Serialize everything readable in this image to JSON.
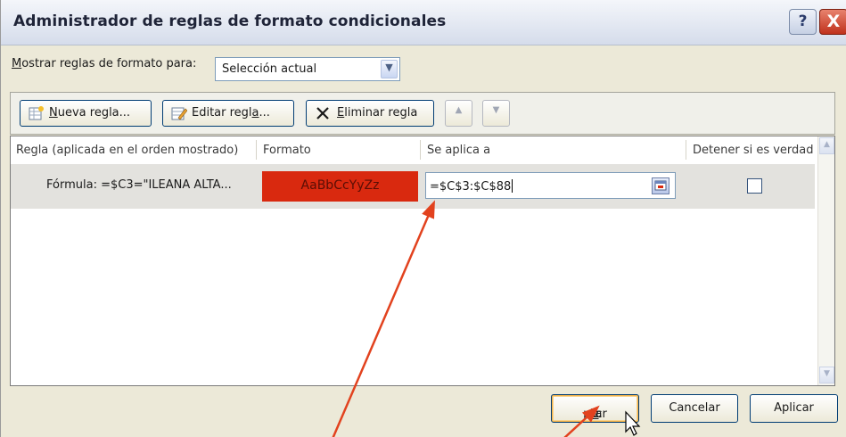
{
  "dialog": {
    "title": "Administrador de reglas de formato condicionales",
    "help_label": "?",
    "close_label": "X"
  },
  "filter": {
    "label_underlined": "M",
    "label_rest": "ostrar reglas de formato para:",
    "selected": "Selección actual",
    "arrow": "▼"
  },
  "toolbar": {
    "new_rule": {
      "u": "N",
      "rest": "ueva regla..."
    },
    "edit_rule": {
      "pre": "Editar regl",
      "u": "a",
      "post": "..."
    },
    "delete_rule": {
      "u": "E",
      "rest": "liminar regla"
    },
    "move_up": "▲",
    "move_down": "▼"
  },
  "table": {
    "headers": [
      "Regla (aplicada en el orden mostrado)",
      "Formato",
      "Se aplica a",
      "Detener si es verdad"
    ],
    "rows": [
      {
        "rule": "Fórmula: =$C3=\"ILEANA ALTA...",
        "format_preview": "AaBbCcYyZz",
        "applies_to": "=$C$3:$C$88",
        "stop_if_true": false
      }
    ]
  },
  "footer": {
    "ok": {
      "pre": "Ac",
      "u": "e",
      "post": "ptar"
    },
    "cancel": "Cancelar",
    "apply": "Aplicar"
  },
  "colors": {
    "format_preview_bg": "#d9290f",
    "annotation_arrow": "#e2421e"
  }
}
